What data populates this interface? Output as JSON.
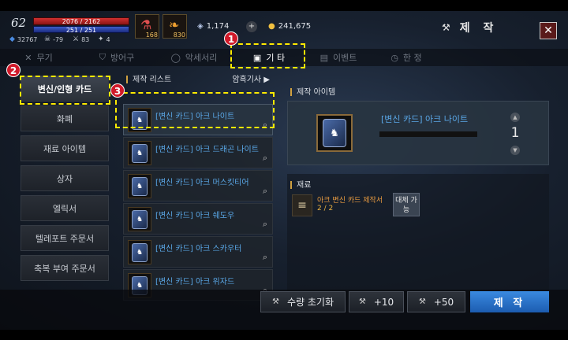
{
  "player": {
    "level": "62",
    "hp": "2076 / 2162",
    "mp": "251 / 251",
    "stats": [
      "32767",
      "-79",
      "83",
      "4"
    ]
  },
  "quick_slots": [
    {
      "count": "168"
    },
    {
      "count": "830"
    }
  ],
  "currency": {
    "crystal": "1,174",
    "plus": "+",
    "gold": "241,675"
  },
  "window": {
    "title": "제 작",
    "close": "✕"
  },
  "tabs": [
    {
      "label": "무기"
    },
    {
      "label": "방어구"
    },
    {
      "label": "악세서리"
    },
    {
      "label": "기 타"
    },
    {
      "label": "이벤트"
    },
    {
      "label": "한 정"
    }
  ],
  "categories": [
    {
      "label": "변신/인형 카드"
    },
    {
      "label": "화폐"
    },
    {
      "label": "재료 아이템"
    },
    {
      "label": "상자"
    },
    {
      "label": "엘릭서"
    },
    {
      "label": "텔레포트 주문서"
    },
    {
      "label": "축복 부여 주문서"
    }
  ],
  "list": {
    "header": "제작 리스트",
    "shortcut": "암흑기사 ▶",
    "items": [
      {
        "name": "[변신 카드] 아크 나이트"
      },
      {
        "name": "[변신 카드] 아크 드래곤 나이트"
      },
      {
        "name": "[변신 카드] 아크 머스킷티어"
      },
      {
        "name": "[변신 카드] 아크 쉐도우"
      },
      {
        "name": "[변신 카드] 아크 스카우터"
      },
      {
        "name": "[변신 카드] 아크 위자드"
      }
    ]
  },
  "detail": {
    "header": "제작 아이템",
    "name": "[변신 카드] 아크 나이트",
    "quantity": "1"
  },
  "materials": {
    "header": "재료",
    "items": [
      {
        "name": "아크 변신 카드 제작서",
        "count": "2 / 2",
        "substitute": "대체 가능"
      }
    ]
  },
  "buttons": {
    "reset": "수량 초기화",
    "plus10": "+10",
    "plus50": "+50",
    "craft": "제 작"
  },
  "annotations": [
    "1",
    "2",
    "3"
  ],
  "colors": {
    "item_name": "#5aa8e8",
    "highlight": "#ffea00",
    "badge": "#d11a2a",
    "craft_button": "#2a76d0"
  }
}
